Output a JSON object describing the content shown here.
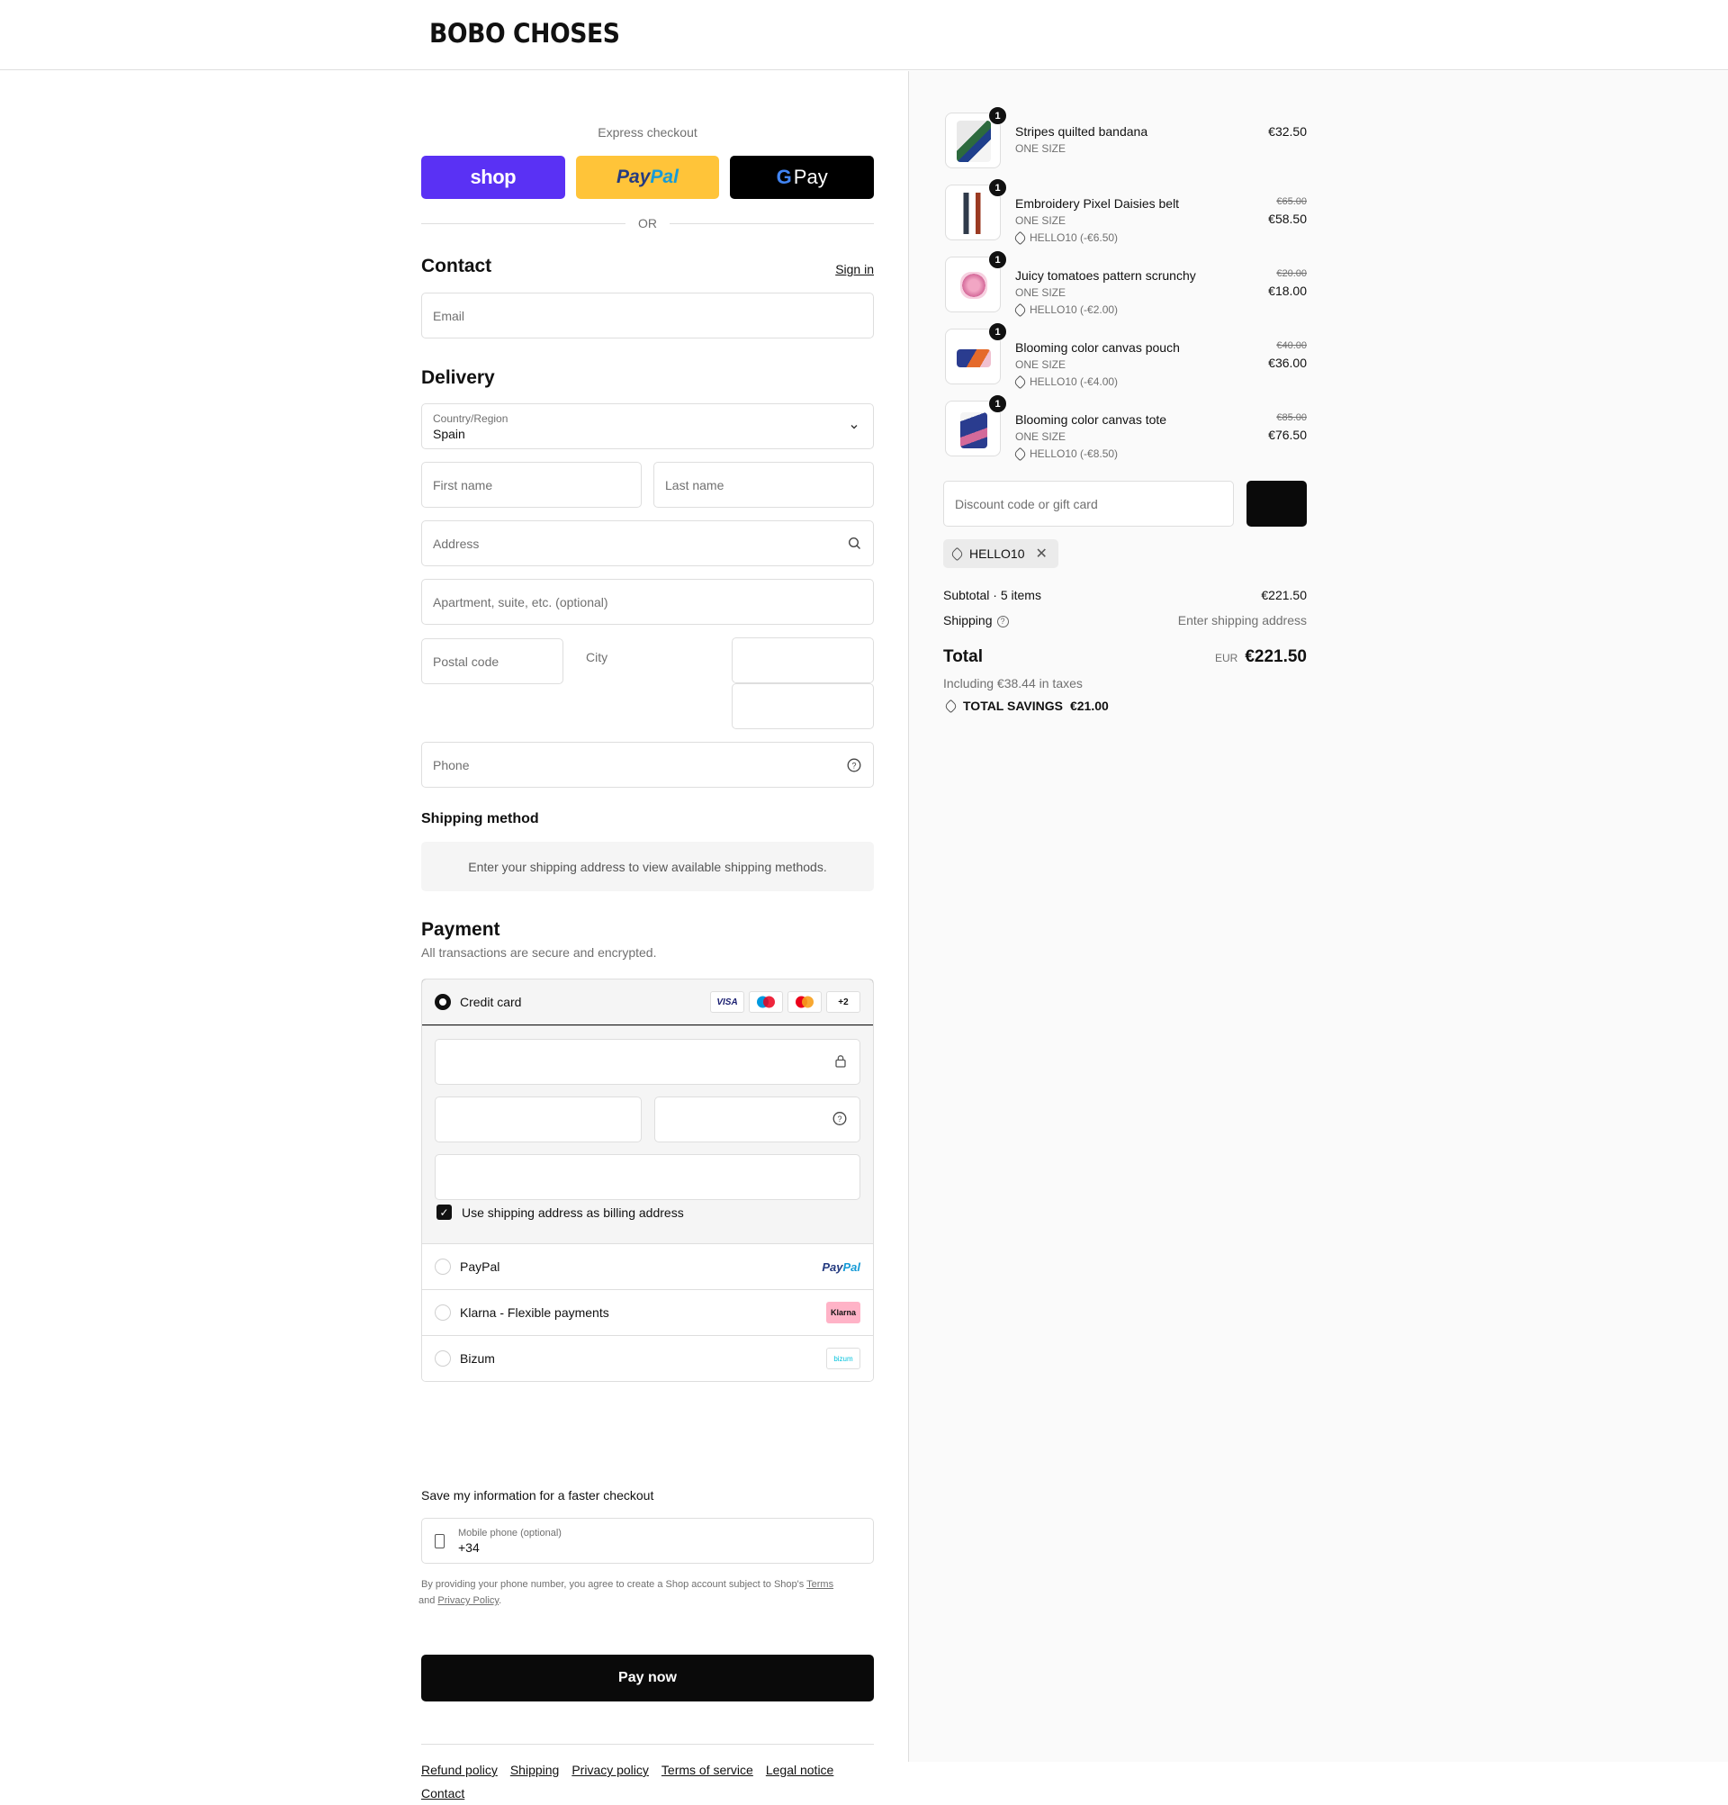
{
  "brand": {
    "logo": "BOBO CHOSES"
  },
  "express": {
    "title": "Express checkout",
    "shop_label": "shop",
    "paypal_label_a": "Pay",
    "paypal_label_b": "Pal",
    "gpay_g": "G",
    "gpay_label": "Pay",
    "or_label": "OR"
  },
  "contact": {
    "title": "Contact",
    "sign_in": "Sign in",
    "email_placeholder": "Email"
  },
  "delivery": {
    "title": "Delivery",
    "country_label": "Country/Region",
    "country_value": "Spain",
    "first_name": "First name",
    "last_name": "Last name",
    "address": "Address",
    "apartment": "Apartment, suite, etc. (optional)",
    "postal_code": "Postal code",
    "city": "City",
    "phone": "Phone"
  },
  "shipping_method": {
    "title": "Shipping method",
    "message": "Enter your shipping address to view available shipping methods."
  },
  "payment": {
    "title": "Payment",
    "subtitle": "All transactions are secure and encrypted.",
    "credit_card": "Credit card",
    "cards": [
      "VISA",
      "",
      "",
      "+2"
    ],
    "billing_checkbox": "Use shipping address as billing address",
    "paypal": "PayPal",
    "paypal_brand_a": "Pay",
    "paypal_brand_b": "Pal",
    "klarna": "Klarna - Flexible payments",
    "klarna_brand": "Klarna",
    "bizum": "Bizum",
    "bizum_brand": "bizum"
  },
  "save_info": {
    "title": "Save my information for a faster checkout",
    "phone_label": "Mobile phone (optional)",
    "phone_value": "+34",
    "legal_a": "By providing your phone number, you agree to create a Shop account subject to Shop's ",
    "terms": "Terms",
    "legal_b": " and ",
    "privacy": "Privacy Policy",
    "legal_c": "."
  },
  "pay_now": "Pay now",
  "footer": [
    "Refund policy",
    "Shipping",
    "Privacy policy",
    "Terms of service",
    "Legal notice",
    "Contact"
  ],
  "order": {
    "items": [
      {
        "name": "Stripes quilted bandana",
        "size": "ONE SIZE",
        "qty": "1",
        "price": "€32.50",
        "old_price": "",
        "discount": ""
      },
      {
        "name": "Embroidery Pixel Daisies belt",
        "size": "ONE SIZE",
        "qty": "1",
        "price": "€58.50",
        "old_price": "€65.00",
        "discount": "HELLO10 (-€6.50)"
      },
      {
        "name": "Juicy tomatoes pattern scrunchy",
        "size": "ONE SIZE",
        "qty": "1",
        "price": "€18.00",
        "old_price": "€20.00",
        "discount": "HELLO10 (-€2.00)"
      },
      {
        "name": "Blooming color canvas pouch",
        "size": "ONE SIZE",
        "qty": "1",
        "price": "€36.00",
        "old_price": "€40.00",
        "discount": "HELLO10 (-€4.00)"
      },
      {
        "name": "Blooming color canvas tote",
        "size": "ONE SIZE",
        "qty": "1",
        "price": "€76.50",
        "old_price": "€85.00",
        "discount": "HELLO10 (-€8.50)"
      }
    ],
    "discount_placeholder": "Discount code or gift card",
    "applied_code": "HELLO10",
    "subtotal_label": "Subtotal · 5 items",
    "subtotal_value": "€221.50",
    "shipping_label": "Shipping",
    "shipping_value": "Enter shipping address",
    "total_label": "Total",
    "currency": "EUR",
    "total_value": "€221.50",
    "taxes": "Including €38.44 in taxes",
    "savings_label": "TOTAL SAVINGS",
    "savings_value": "€21.00"
  }
}
